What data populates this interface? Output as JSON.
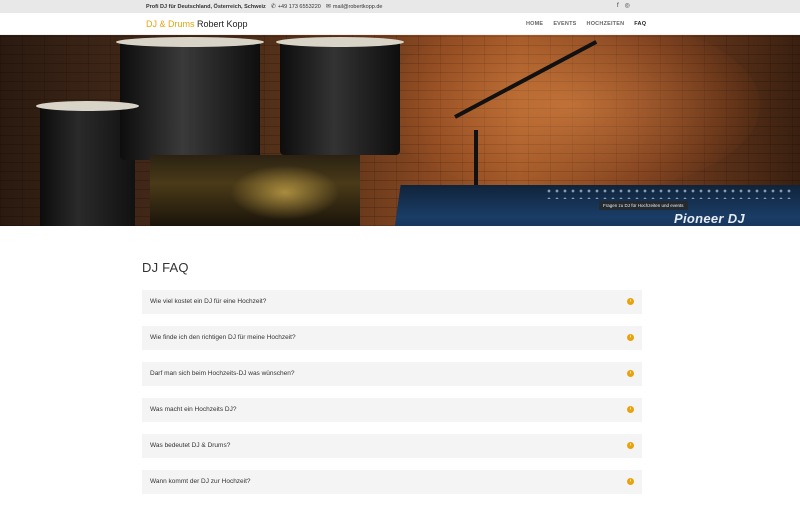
{
  "topbar": {
    "tagline": "Profi DJ für Deutschland, Österreich, Schweiz",
    "phone": "+49 173 6553220",
    "email": "mail@robertkopp.de",
    "social": [
      {
        "icon": "facebook-icon",
        "glyph": "f"
      },
      {
        "icon": "instagram-icon",
        "glyph": "◎"
      }
    ]
  },
  "header": {
    "logo_brand": "DJ & Drums",
    "logo_name": "Robert Kopp",
    "nav": [
      {
        "label": "HOME",
        "active": false
      },
      {
        "label": "EVENTS",
        "active": false
      },
      {
        "label": "HOCHZEITEN",
        "active": false
      },
      {
        "label": "FAQ",
        "active": true
      }
    ]
  },
  "hero": {
    "caption": "Fragen zu DJ für Hochzeiten und events",
    "brand_text": "Pioneer DJ"
  },
  "main": {
    "title": "DJ FAQ",
    "faq": [
      {
        "question": "Wie viel kostet ein DJ für eine Hochzeit?"
      },
      {
        "question": "Wie finde ich den richtigen DJ für meine Hochzeit?"
      },
      {
        "question": "Darf man sich beim Hochzeits-DJ was wünschen?"
      },
      {
        "question": "Was macht ein Hochzeits DJ?"
      },
      {
        "question": "Was bedeutet DJ & Drums?"
      },
      {
        "question": "Wann kommt der DJ zur Hochzeit?"
      }
    ]
  },
  "colors": {
    "accent": "#e8a30c",
    "faq_bg": "#f4f4f4",
    "topbar_bg": "#e8e8e8"
  }
}
